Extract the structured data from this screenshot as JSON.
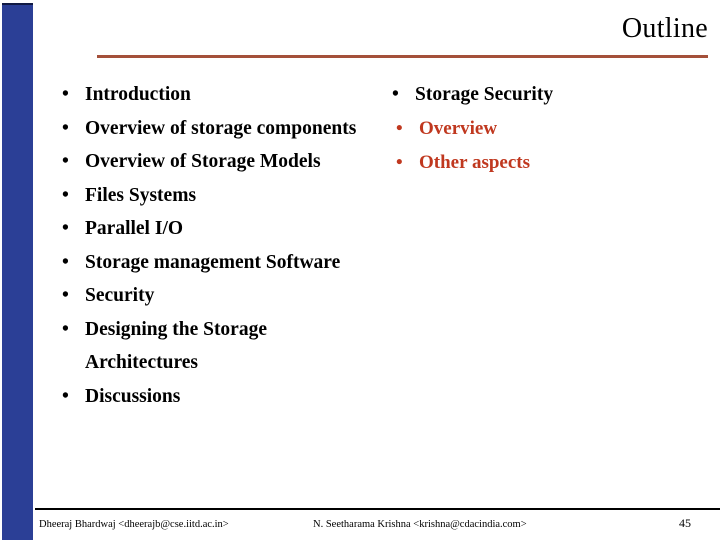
{
  "slide": {
    "title": "Outline",
    "page_number": "45",
    "accent_rule_color": "#a4503a",
    "sidebar_color": "#2b3f96",
    "subbullet_color": "#c0381f",
    "bullet_glyph": "•"
  },
  "content": {
    "left_column": [
      {
        "label": "Introduction"
      },
      {
        "label": "Overview of storage components"
      },
      {
        "label": "Overview of Storage Models"
      },
      {
        "label": "Files Systems"
      },
      {
        "label": "Parallel I/O"
      },
      {
        "label": "Storage management Software"
      },
      {
        "label": "Security"
      },
      {
        "label": "Designing the Storage Architectures"
      },
      {
        "label": "Discussions"
      }
    ],
    "right_column": [
      {
        "label": "Storage Security",
        "children": [
          {
            "label": "Overview"
          },
          {
            "label": "Other aspects"
          }
        ]
      }
    ]
  },
  "footer": {
    "author_1": "Dheeraj Bhardwaj <dheerajb@cse.iitd.ac.in>",
    "author_2": "N. Seetharama Krishna <krishna@cdacindia.com>"
  }
}
